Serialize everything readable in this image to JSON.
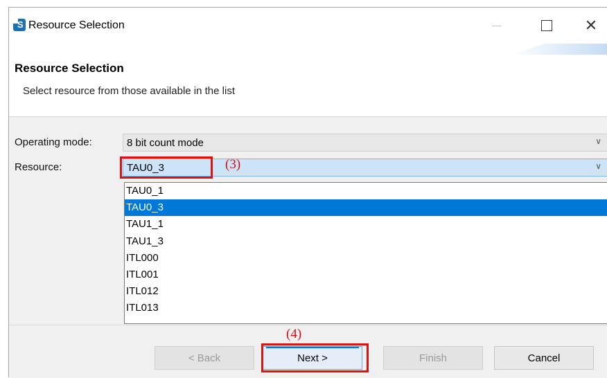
{
  "window": {
    "title": "Resource Selection",
    "controls": {
      "minimize": "—",
      "maximize": "",
      "close": "✕"
    }
  },
  "header": {
    "title": "Resource Selection",
    "description": "Select resource from those available in the list"
  },
  "form": {
    "operating_mode": {
      "label": "Operating mode:",
      "value": "8 bit count mode"
    },
    "resource": {
      "label": "Resource:",
      "value": "TAU0_3",
      "options": [
        "TAU0_1",
        "TAU0_3",
        "TAU1_1",
        "TAU1_3",
        "ITL000",
        "ITL001",
        "ITL012",
        "ITL013"
      ],
      "selected_index": 1
    }
  },
  "annotations": {
    "step3": "(3)",
    "step4": "(4)"
  },
  "buttons": {
    "back": "< Back",
    "next": "Next >",
    "finish": "Finish",
    "cancel": "Cancel"
  },
  "icons": {
    "app": "app-logo-icon",
    "dropdown": "chevron-down-icon"
  },
  "colors": {
    "selection": "#0078d7",
    "annotation": "#e01010",
    "combo_active": "#cde3f7"
  }
}
